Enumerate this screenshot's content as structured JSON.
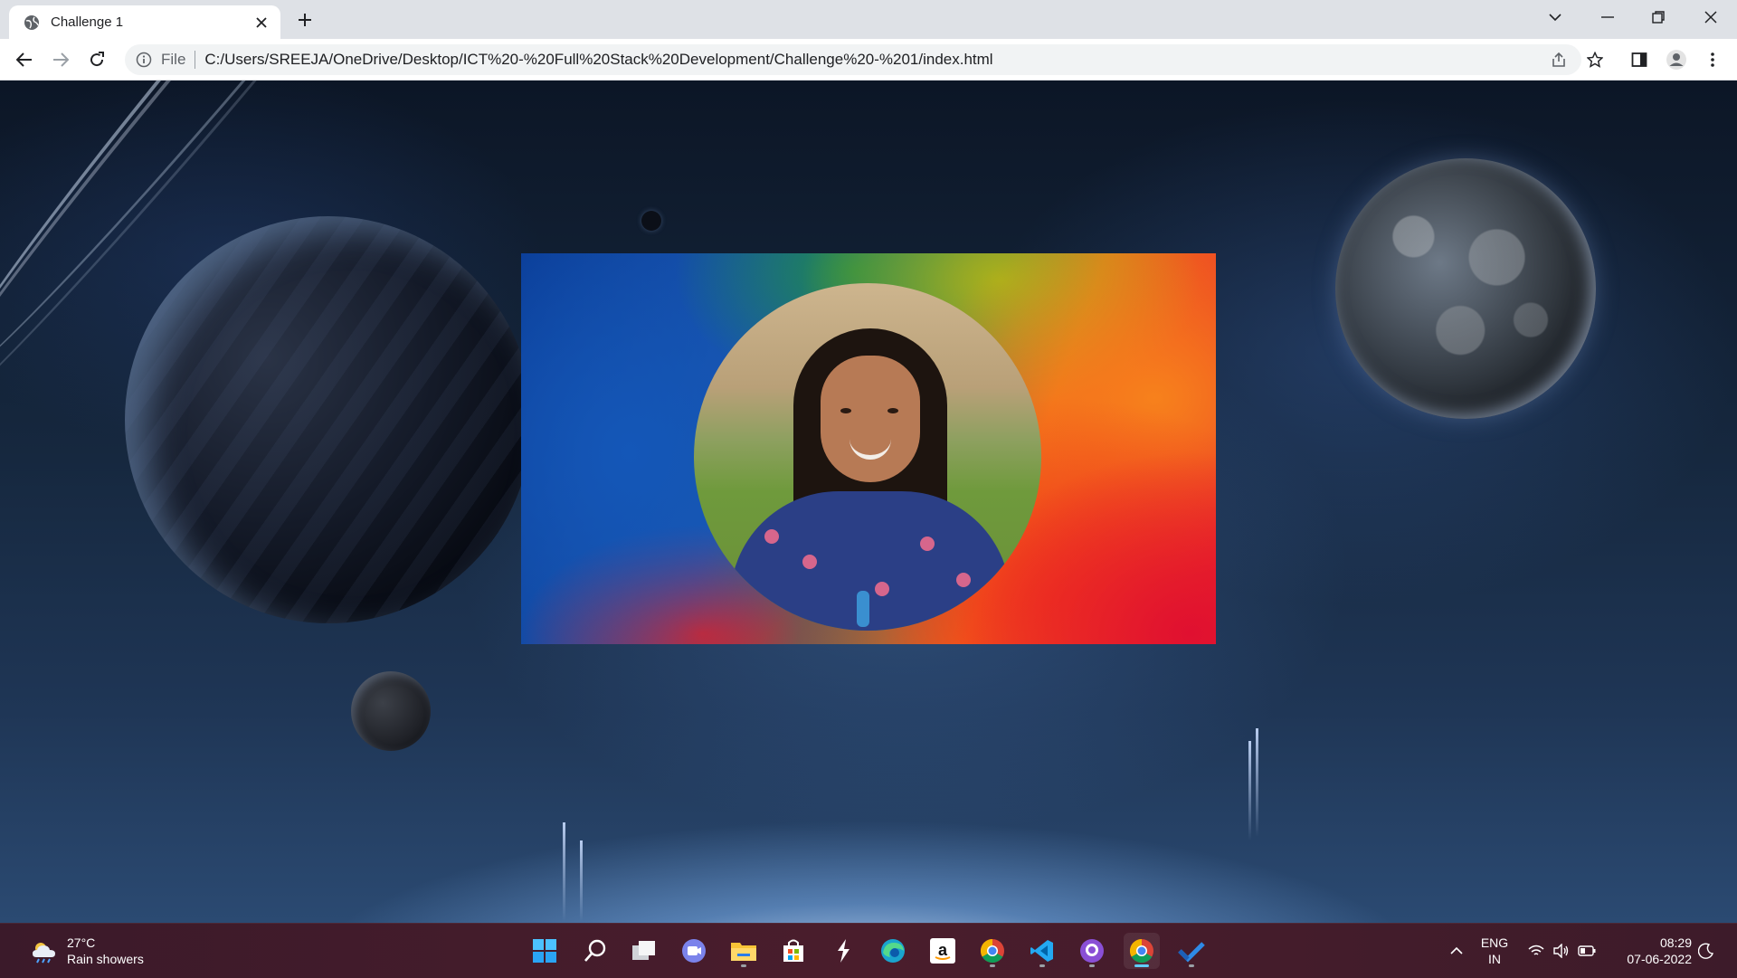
{
  "browser": {
    "tab_title": "Challenge 1",
    "omnibox_scheme": "File",
    "url": "C:/Users/SREEJA/OneDrive/Desktop/ICT%20-%20Full%20Stack%20Development/Challenge%20-%201/index.html"
  },
  "colors": {
    "chrome_tabbar": "#dee1e6",
    "omnibox": "#f1f3f4",
    "taskbar": "#4a1d2c",
    "accent": "#60cdff"
  },
  "page": {
    "background": "space scene with planets",
    "card_image": "profile photo inside circle on colorful paint-swirl background"
  },
  "taskbar": {
    "weather_temp": "27°C",
    "weather_desc": "Rain showers",
    "apps": [
      "start-icon",
      "search-icon",
      "task-view-icon",
      "teams-chat-icon",
      "file-explorer-icon",
      "microsoft-store-icon",
      "sublime-icon",
      "edge-icon",
      "amazon-icon",
      "chrome-alt-icon",
      "vscode-icon",
      "github-desktop-icon",
      "chrome-icon",
      "ms-to-do-icon"
    ],
    "lang_top": "ENG",
    "lang_bottom": "IN",
    "time": "08:29",
    "date": "07-06-2022"
  }
}
